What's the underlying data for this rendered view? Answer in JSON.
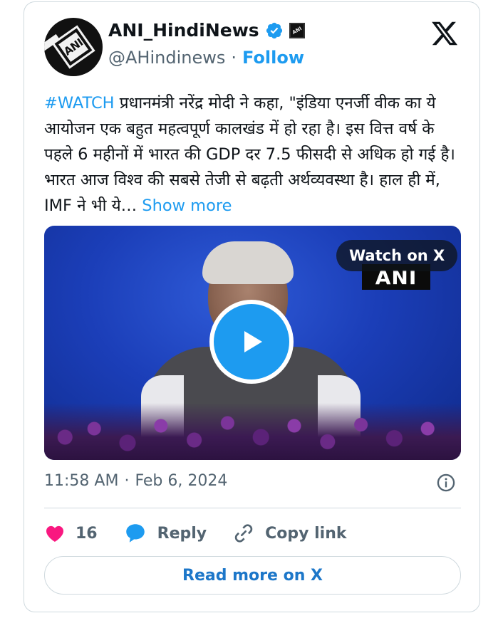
{
  "author": {
    "avatar_text": "ANI",
    "name": "ANI_HindiNews",
    "handle": "@AHindinews",
    "separator": "·",
    "follow_label": "Follow"
  },
  "tweet": {
    "hashtag": "#WATCH",
    "body": " प्रधानमंत्री नरेंद्र मोदी ने कहा, \"इंडिया एनर्जी वीक का ये आयोजन एक बहुत महत्वपूर्ण कालखंड में हो रहा है। इस वित्त वर्ष के पहले 6 महीनों में भारत की GDP दर 7.5 फीसदी से अधिक हो गई है।  भारत आज विश्व की सबसे तेजी से बढ़ती अर्थव्यवस्था है। हाल ही में, IMF ने भी ये… ",
    "show_more": "Show more"
  },
  "media": {
    "watch_label": "Watch on X",
    "watermark": "ANI"
  },
  "meta": {
    "time": "11:58 AM",
    "separator": "·",
    "date": "Feb 6, 2024"
  },
  "actions": {
    "like_count": "16",
    "reply_label": "Reply",
    "copy_link_label": "Copy link"
  },
  "read_more_label": "Read more on X",
  "colors": {
    "accent": "#1d9bf0",
    "like": "#f91880",
    "text_secondary": "#536471",
    "border": "#cfd9de"
  }
}
